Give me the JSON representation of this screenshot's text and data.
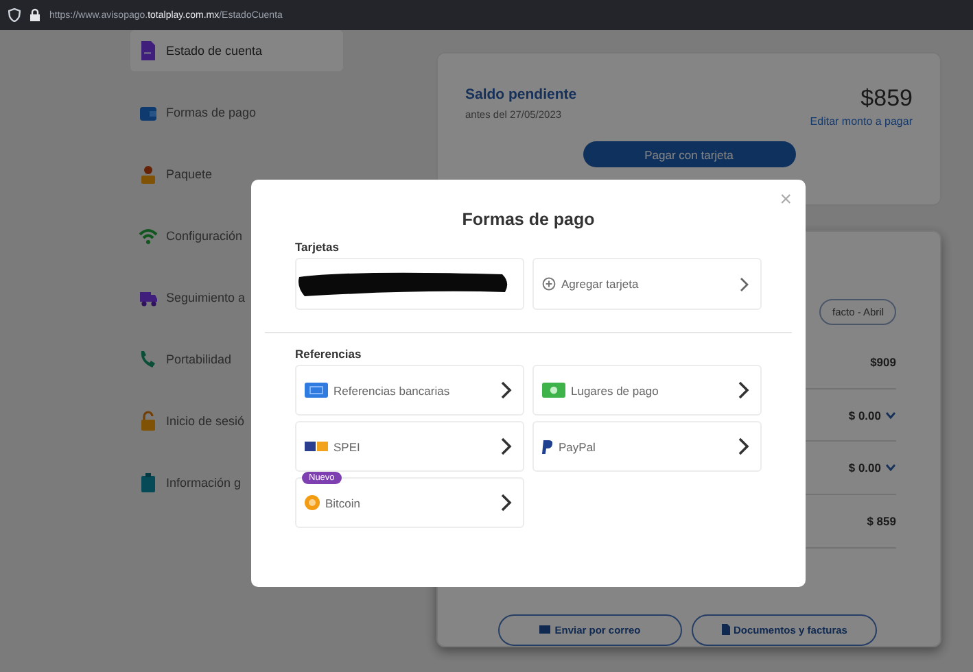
{
  "browser": {
    "url": "https://www.avisopago.**totalplay.com.mx**/EstadoCuenta"
  },
  "sidebar": {
    "items": [
      {
        "label": "Estado de cuenta",
        "kind": "document",
        "selected": true
      },
      {
        "label": "Formas de pago",
        "kind": "wallet",
        "selected": false
      },
      {
        "label": "Paquete",
        "kind": "package",
        "selected": false
      },
      {
        "label": "Configuración",
        "kind": "wifi",
        "selected": false
      },
      {
        "label": "Seguimiento a",
        "kind": "truck",
        "selected": false
      },
      {
        "label": "Portabilidad",
        "kind": "phone",
        "selected": false
      },
      {
        "label": "Inicio de sesió",
        "kind": "lock",
        "selected": false
      },
      {
        "label": "Información g",
        "kind": "clipboard",
        "selected": false
      }
    ]
  },
  "balance": {
    "title": "Saldo pendiente",
    "due": "antes del 27/05/2023",
    "amount": "$859",
    "edit_link": "Editar monto a pagar",
    "pay_button": "Pagar con tarjeta"
  },
  "statement": {
    "period_chip": "facto - Abril",
    "rows": [
      {
        "value": "$909",
        "expandable": false
      },
      {
        "value": "$ 0.00",
        "expandable": true
      },
      {
        "value": "$ 0.00",
        "expandable": true
      },
      {
        "value": "$ 859",
        "expandable": false
      }
    ],
    "buttons": [
      {
        "label": "Enviar por correo",
        "kind": "mail"
      },
      {
        "label": "Documentos y facturas",
        "kind": "document"
      }
    ]
  },
  "modal": {
    "title": "Formas de pago",
    "close": "×",
    "cards_heading": "Tarjetas",
    "cards": [
      {
        "kind": "redacted"
      },
      {
        "kind": "add",
        "label": "Agregar tarjeta"
      }
    ],
    "references_heading": "Referencias",
    "references": [
      {
        "label": "Referencias bancarias",
        "kind": "bank"
      },
      {
        "label": "Lugares de pago",
        "kind": "cash"
      },
      {
        "label": "SPEI",
        "kind": "spei"
      },
      {
        "label": "PayPal",
        "kind": "paypal"
      },
      {
        "label": "Bitcoin",
        "kind": "bitcoin",
        "badge": "Nuevo"
      }
    ]
  }
}
